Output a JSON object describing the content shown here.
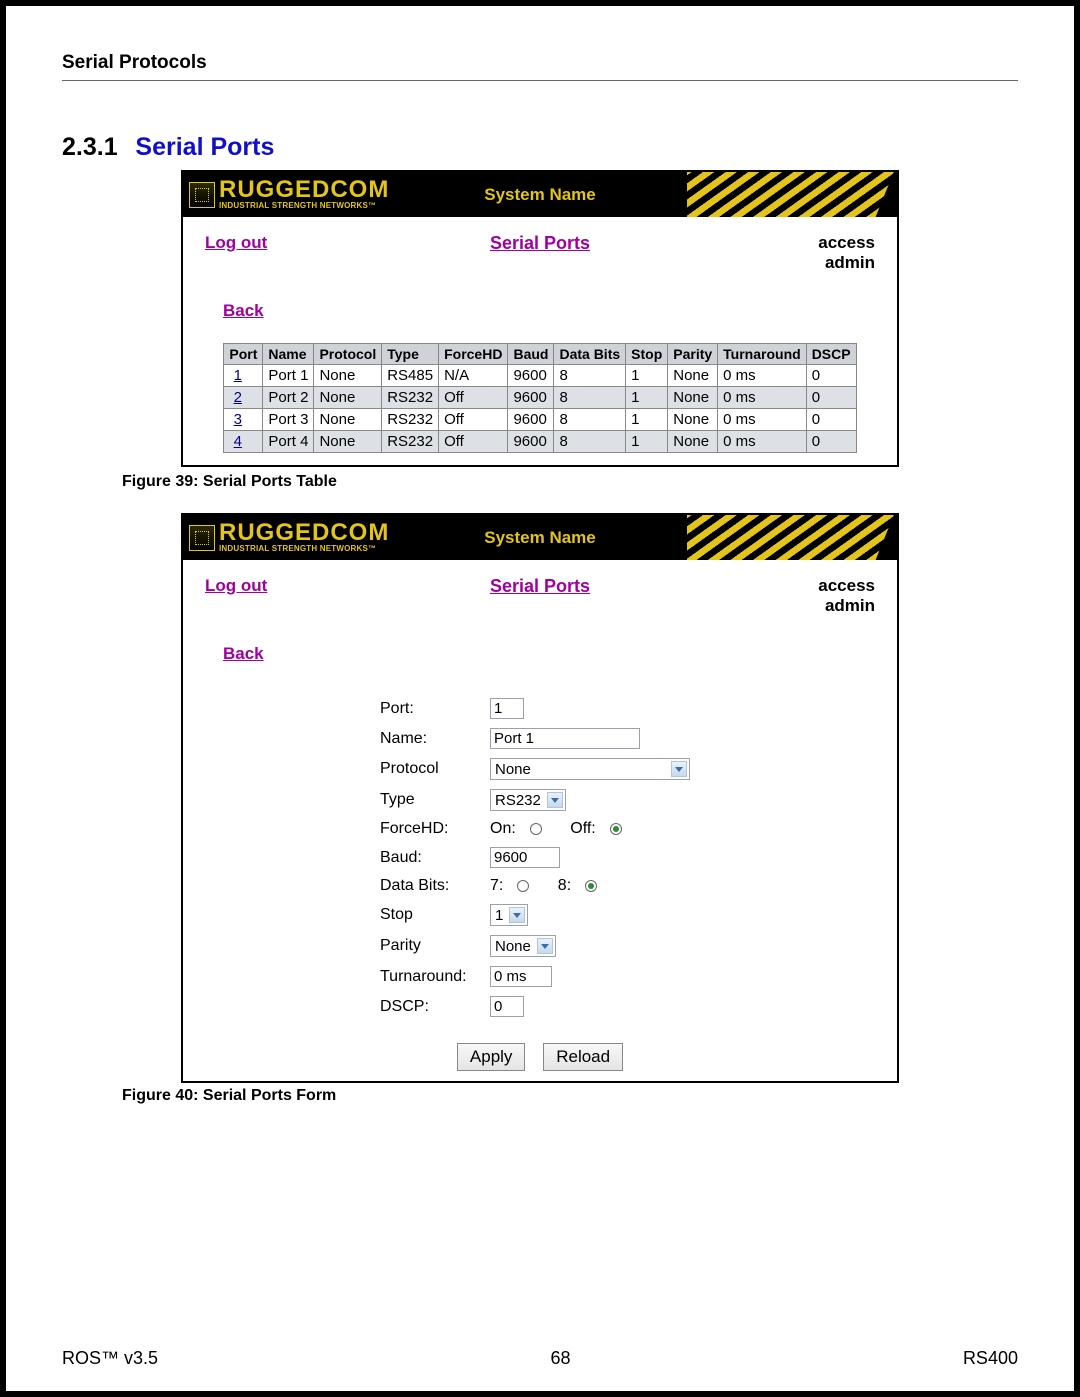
{
  "doc_section": "Serial Protocols",
  "heading": {
    "number": "2.3.1",
    "title": "Serial Ports"
  },
  "brand": {
    "name": "RUGGEDCOM",
    "tagline": "INDUSTRIAL STRENGTH NETWORKS™",
    "system_label": "System Name"
  },
  "nav": {
    "logout": "Log out",
    "page_title": "Serial Ports",
    "access_line1": "access",
    "access_line2": "admin",
    "back": "Back"
  },
  "table": {
    "headers": [
      "Port",
      "Name",
      "Protocol",
      "Type",
      "ForceHD",
      "Baud",
      "Data Bits",
      "Stop",
      "Parity",
      "Turnaround",
      "DSCP"
    ],
    "rows": [
      {
        "port": "1",
        "name": "Port 1",
        "protocol": "None",
        "type": "RS485",
        "forcehd": "N/A",
        "baud": "9600",
        "data": "8",
        "stop": "1",
        "parity": "None",
        "turn": "0 ms",
        "dscp": "0"
      },
      {
        "port": "2",
        "name": "Port 2",
        "protocol": "None",
        "type": "RS232",
        "forcehd": "Off",
        "baud": "9600",
        "data": "8",
        "stop": "1",
        "parity": "None",
        "turn": "0 ms",
        "dscp": "0"
      },
      {
        "port": "3",
        "name": "Port 3",
        "protocol": "None",
        "type": "RS232",
        "forcehd": "Off",
        "baud": "9600",
        "data": "8",
        "stop": "1",
        "parity": "None",
        "turn": "0 ms",
        "dscp": "0"
      },
      {
        "port": "4",
        "name": "Port 4",
        "protocol": "None",
        "type": "RS232",
        "forcehd": "Off",
        "baud": "9600",
        "data": "8",
        "stop": "1",
        "parity": "None",
        "turn": "0 ms",
        "dscp": "0"
      }
    ]
  },
  "caption1": "Figure 39: Serial Ports Table",
  "form": {
    "port": {
      "label": "Port:",
      "value": "1"
    },
    "name": {
      "label": "Name:",
      "value": "Port 1"
    },
    "protocol": {
      "label": "Protocol",
      "value": "None"
    },
    "type": {
      "label": "Type",
      "value": "RS232"
    },
    "forcehd": {
      "label": "ForceHD:",
      "on": "On:",
      "off": "Off:",
      "selected": "off"
    },
    "baud": {
      "label": "Baud:",
      "value": "9600"
    },
    "databits": {
      "label": "Data Bits:",
      "l7": "7:",
      "l8": "8:",
      "selected": "8"
    },
    "stop": {
      "label": "Stop",
      "value": "1"
    },
    "parity": {
      "label": "Parity",
      "value": "None"
    },
    "turnaround": {
      "label": "Turnaround:",
      "value": "0 ms"
    },
    "dscp": {
      "label": "DSCP:",
      "value": "0"
    }
  },
  "buttons": {
    "apply": "Apply",
    "reload": "Reload"
  },
  "caption2": "Figure 40: Serial Ports Form",
  "footer": {
    "left": "ROS™  v3.5",
    "center": "68",
    "right": "RS400"
  }
}
